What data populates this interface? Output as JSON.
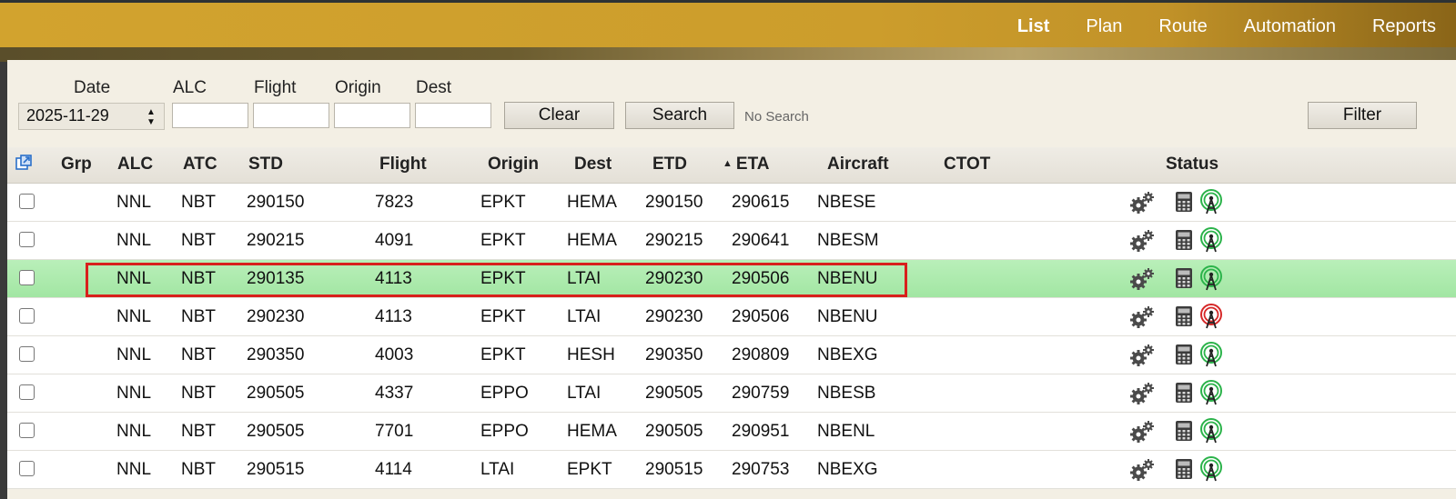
{
  "nav": {
    "items": [
      {
        "label": "List",
        "active": true
      },
      {
        "label": "Plan",
        "active": false
      },
      {
        "label": "Route",
        "active": false
      },
      {
        "label": "Automation",
        "active": false
      },
      {
        "label": "Reports",
        "active": false
      }
    ]
  },
  "filters": {
    "date_label": "Date",
    "date_value": "2025-11-29",
    "alc_label": "ALC",
    "flight_label": "Flight",
    "origin_label": "Origin",
    "dest_label": "Dest",
    "clear_label": "Clear",
    "search_label": "Search",
    "status_text": "No Search",
    "filter_label": "Filter"
  },
  "table": {
    "headers": {
      "grp": "Grp",
      "alc": "ALC",
      "atc": "ATC",
      "std": "STD",
      "flight": "Flight",
      "origin": "Origin",
      "dest": "Dest",
      "etd": "ETD",
      "eta": "ETA",
      "aircraft": "Aircraft",
      "ctot": "CTOT",
      "status": "Status"
    },
    "sort_indicator": "▲",
    "rows": [
      {
        "alc": "NNL",
        "atc": "NBT",
        "std": "290150",
        "flight": "7823",
        "origin": "EPKT",
        "dest": "HEMA",
        "etd": "290150",
        "eta": "290615",
        "aircraft": "NBESE",
        "signal": "green"
      },
      {
        "alc": "NNL",
        "atc": "NBT",
        "std": "290215",
        "flight": "4091",
        "origin": "EPKT",
        "dest": "HEMA",
        "etd": "290215",
        "eta": "290641",
        "aircraft": "NBESM",
        "signal": "green"
      },
      {
        "alc": "NNL",
        "atc": "NBT",
        "std": "290135",
        "flight": "4113",
        "origin": "EPKT",
        "dest": "LTAI",
        "etd": "290230",
        "eta": "290506",
        "aircraft": "NBENU",
        "signal": "green",
        "selected": true
      },
      {
        "alc": "NNL",
        "atc": "NBT",
        "std": "290230",
        "flight": "4113",
        "origin": "EPKT",
        "dest": "LTAI",
        "etd": "290230",
        "eta": "290506",
        "aircraft": "NBENU",
        "signal": "red"
      },
      {
        "alc": "NNL",
        "atc": "NBT",
        "std": "290350",
        "flight": "4003",
        "origin": "EPKT",
        "dest": "HESH",
        "etd": "290350",
        "eta": "290809",
        "aircraft": "NBEXG",
        "signal": "green"
      },
      {
        "alc": "NNL",
        "atc": "NBT",
        "std": "290505",
        "flight": "4337",
        "origin": "EPPO",
        "dest": "LTAI",
        "etd": "290505",
        "eta": "290759",
        "aircraft": "NBESB",
        "signal": "green"
      },
      {
        "alc": "NNL",
        "atc": "NBT",
        "std": "290505",
        "flight": "7701",
        "origin": "EPPO",
        "dest": "HEMA",
        "etd": "290505",
        "eta": "290951",
        "aircraft": "NBENL",
        "signal": "green"
      },
      {
        "alc": "NNL",
        "atc": "NBT",
        "std": "290515",
        "flight": "4114",
        "origin": "LTAI",
        "dest": "EPKT",
        "etd": "290515",
        "eta": "290753",
        "aircraft": "NBEXG",
        "signal": "green"
      }
    ]
  },
  "colors": {
    "topbar": "#d2a32e",
    "selected_row": "#a8e8a9",
    "highlight_border": "#d8201c",
    "signal_green": "#2bb34a",
    "signal_red": "#d62828"
  },
  "icons": {
    "external": "external-link-icon",
    "gear": "gears-icon",
    "calculator": "calculator-icon",
    "antenna": "radio-antenna-icon"
  }
}
